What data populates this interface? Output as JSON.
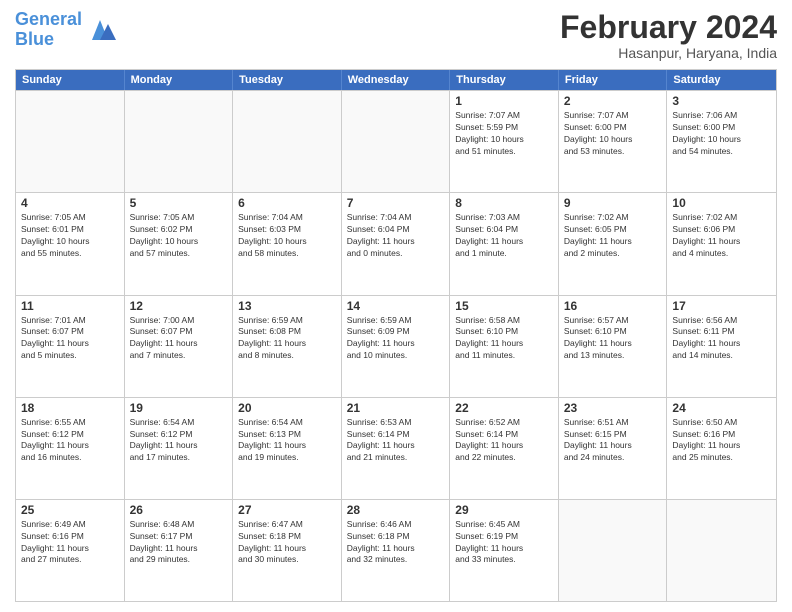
{
  "logo": {
    "line1": "General",
    "line2": "Blue"
  },
  "title": "February 2024",
  "subtitle": "Hasanpur, Haryana, India",
  "weekdays": [
    "Sunday",
    "Monday",
    "Tuesday",
    "Wednesday",
    "Thursday",
    "Friday",
    "Saturday"
  ],
  "rows": [
    [
      {
        "day": "",
        "info": ""
      },
      {
        "day": "",
        "info": ""
      },
      {
        "day": "",
        "info": ""
      },
      {
        "day": "",
        "info": ""
      },
      {
        "day": "1",
        "info": "Sunrise: 7:07 AM\nSunset: 5:59 PM\nDaylight: 10 hours\nand 51 minutes."
      },
      {
        "day": "2",
        "info": "Sunrise: 7:07 AM\nSunset: 6:00 PM\nDaylight: 10 hours\nand 53 minutes."
      },
      {
        "day": "3",
        "info": "Sunrise: 7:06 AM\nSunset: 6:00 PM\nDaylight: 10 hours\nand 54 minutes."
      }
    ],
    [
      {
        "day": "4",
        "info": "Sunrise: 7:05 AM\nSunset: 6:01 PM\nDaylight: 10 hours\nand 55 minutes."
      },
      {
        "day": "5",
        "info": "Sunrise: 7:05 AM\nSunset: 6:02 PM\nDaylight: 10 hours\nand 57 minutes."
      },
      {
        "day": "6",
        "info": "Sunrise: 7:04 AM\nSunset: 6:03 PM\nDaylight: 10 hours\nand 58 minutes."
      },
      {
        "day": "7",
        "info": "Sunrise: 7:04 AM\nSunset: 6:04 PM\nDaylight: 11 hours\nand 0 minutes."
      },
      {
        "day": "8",
        "info": "Sunrise: 7:03 AM\nSunset: 6:04 PM\nDaylight: 11 hours\nand 1 minute."
      },
      {
        "day": "9",
        "info": "Sunrise: 7:02 AM\nSunset: 6:05 PM\nDaylight: 11 hours\nand 2 minutes."
      },
      {
        "day": "10",
        "info": "Sunrise: 7:02 AM\nSunset: 6:06 PM\nDaylight: 11 hours\nand 4 minutes."
      }
    ],
    [
      {
        "day": "11",
        "info": "Sunrise: 7:01 AM\nSunset: 6:07 PM\nDaylight: 11 hours\nand 5 minutes."
      },
      {
        "day": "12",
        "info": "Sunrise: 7:00 AM\nSunset: 6:07 PM\nDaylight: 11 hours\nand 7 minutes."
      },
      {
        "day": "13",
        "info": "Sunrise: 6:59 AM\nSunset: 6:08 PM\nDaylight: 11 hours\nand 8 minutes."
      },
      {
        "day": "14",
        "info": "Sunrise: 6:59 AM\nSunset: 6:09 PM\nDaylight: 11 hours\nand 10 minutes."
      },
      {
        "day": "15",
        "info": "Sunrise: 6:58 AM\nSunset: 6:10 PM\nDaylight: 11 hours\nand 11 minutes."
      },
      {
        "day": "16",
        "info": "Sunrise: 6:57 AM\nSunset: 6:10 PM\nDaylight: 11 hours\nand 13 minutes."
      },
      {
        "day": "17",
        "info": "Sunrise: 6:56 AM\nSunset: 6:11 PM\nDaylight: 11 hours\nand 14 minutes."
      }
    ],
    [
      {
        "day": "18",
        "info": "Sunrise: 6:55 AM\nSunset: 6:12 PM\nDaylight: 11 hours\nand 16 minutes."
      },
      {
        "day": "19",
        "info": "Sunrise: 6:54 AM\nSunset: 6:12 PM\nDaylight: 11 hours\nand 17 minutes."
      },
      {
        "day": "20",
        "info": "Sunrise: 6:54 AM\nSunset: 6:13 PM\nDaylight: 11 hours\nand 19 minutes."
      },
      {
        "day": "21",
        "info": "Sunrise: 6:53 AM\nSunset: 6:14 PM\nDaylight: 11 hours\nand 21 minutes."
      },
      {
        "day": "22",
        "info": "Sunrise: 6:52 AM\nSunset: 6:14 PM\nDaylight: 11 hours\nand 22 minutes."
      },
      {
        "day": "23",
        "info": "Sunrise: 6:51 AM\nSunset: 6:15 PM\nDaylight: 11 hours\nand 24 minutes."
      },
      {
        "day": "24",
        "info": "Sunrise: 6:50 AM\nSunset: 6:16 PM\nDaylight: 11 hours\nand 25 minutes."
      }
    ],
    [
      {
        "day": "25",
        "info": "Sunrise: 6:49 AM\nSunset: 6:16 PM\nDaylight: 11 hours\nand 27 minutes."
      },
      {
        "day": "26",
        "info": "Sunrise: 6:48 AM\nSunset: 6:17 PM\nDaylight: 11 hours\nand 29 minutes."
      },
      {
        "day": "27",
        "info": "Sunrise: 6:47 AM\nSunset: 6:18 PM\nDaylight: 11 hours\nand 30 minutes."
      },
      {
        "day": "28",
        "info": "Sunrise: 6:46 AM\nSunset: 6:18 PM\nDaylight: 11 hours\nand 32 minutes."
      },
      {
        "day": "29",
        "info": "Sunrise: 6:45 AM\nSunset: 6:19 PM\nDaylight: 11 hours\nand 33 minutes."
      },
      {
        "day": "",
        "info": ""
      },
      {
        "day": "",
        "info": ""
      }
    ]
  ]
}
